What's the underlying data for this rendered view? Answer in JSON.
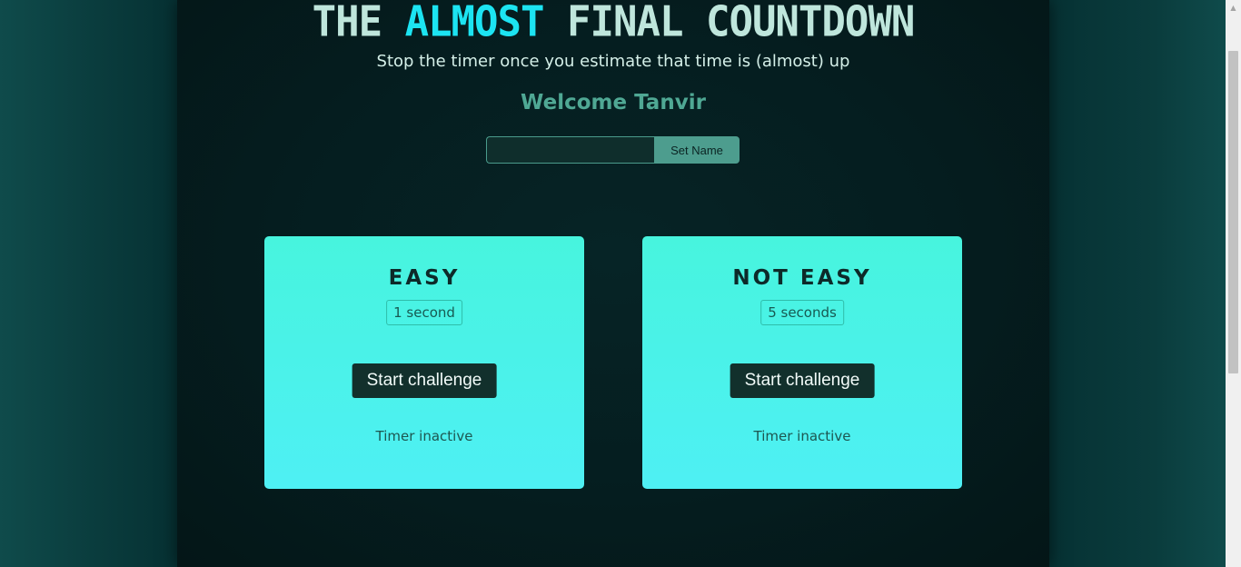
{
  "header": {
    "title_prefix": "THE ",
    "title_accent": "ALMOST",
    "title_suffix": " FINAL COUNTDOWN",
    "subtitle": "Stop the timer once you estimate that time is (almost) up",
    "accent_color": "#1ce4f2"
  },
  "user": {
    "welcome": "Welcome Tanvir",
    "name_input_value": "",
    "set_name_label": "Set Name"
  },
  "challenges": [
    {
      "title": "EASY",
      "duration": "1 second",
      "button_label": "Start challenge",
      "status": "Timer inactive"
    },
    {
      "title": "NOT EASY",
      "duration": "5 seconds",
      "button_label": "Start challenge",
      "status": "Timer inactive"
    }
  ],
  "colors": {
    "card": "#47f4de",
    "button": "#12302c",
    "welcome": "#4fa894"
  }
}
